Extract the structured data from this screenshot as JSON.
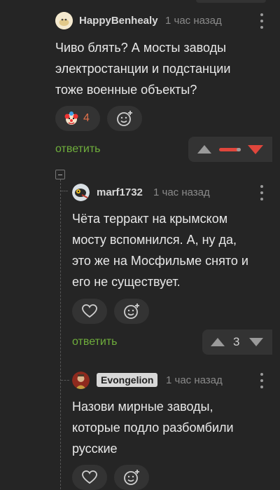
{
  "comments": [
    {
      "username": "HappyBenhealy",
      "timestamp": "1 час назад",
      "text_lines": [
        "Чиво блять? А мосты заводы",
        "электростанции и подстанции",
        "тоже военные объекты?"
      ],
      "reaction_emoji": "clown",
      "reaction_count": "4",
      "reply_label": "ответить",
      "rating_display": "mixed-bar"
    },
    {
      "username": "marf1732",
      "timestamp": "1 час назад",
      "text_lines": [
        "Чёта терракт на крымском",
        "мосту вспомнился. А, ну да,",
        "это же на Мосфильме снято и",
        "его не существует."
      ],
      "reply_label": "ответить",
      "rating": "3"
    },
    {
      "username": "Evongelion",
      "timestamp": "1 час назад",
      "text_lines": [
        "Назови мирные заводы,",
        "которые подло разбомбили",
        "русские"
      ]
    }
  ],
  "colors": {
    "background": "#252525",
    "reply_link": "#6fae3c",
    "downvote_active": "#e0463c",
    "badge_bg": "#d8d8d8"
  }
}
